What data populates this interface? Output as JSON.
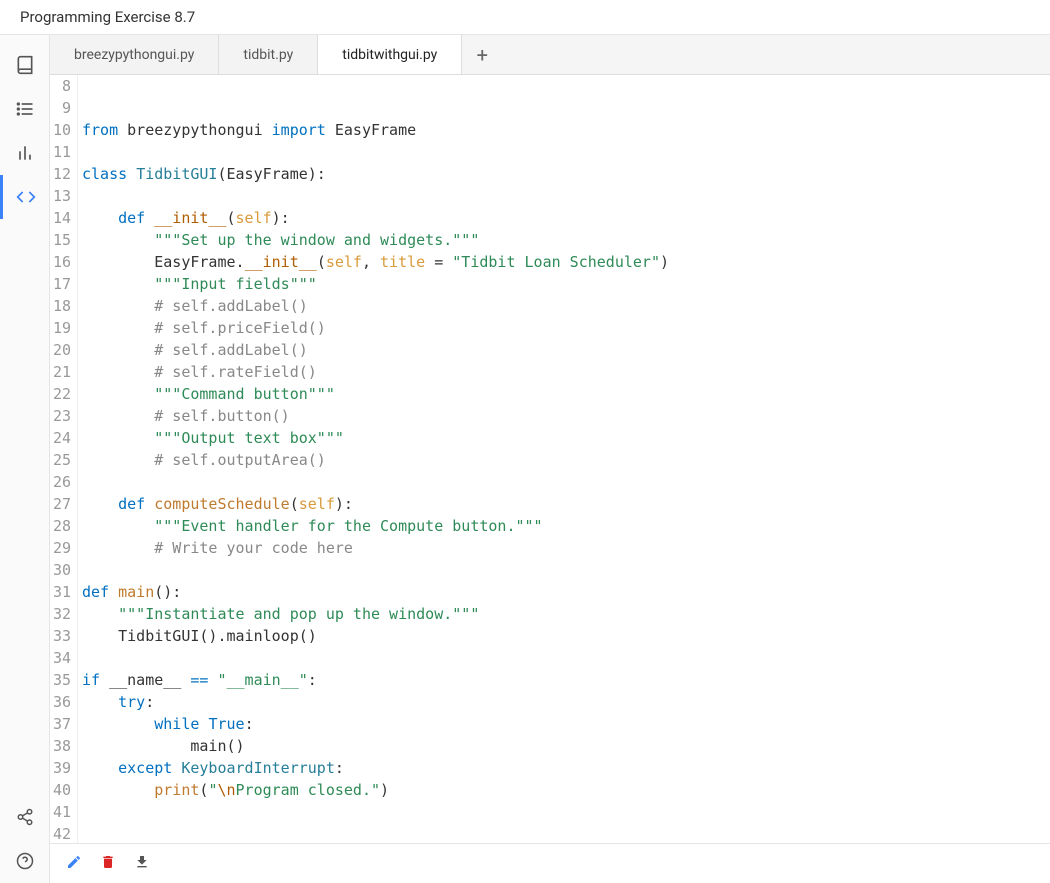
{
  "title": "Programming Exercise 8.7",
  "tabs": [
    {
      "label": "breezypythongui.py",
      "active": false
    },
    {
      "label": "tidbit.py",
      "active": false
    },
    {
      "label": "tidbitwithgui.py",
      "active": true
    }
  ],
  "add_tab_label": "+",
  "line_start": 8,
  "line_end": 42,
  "code_lines": [
    {
      "n": 8,
      "tokens": []
    },
    {
      "n": 9,
      "tokens": []
    },
    {
      "n": 10,
      "tokens": [
        [
          "kw",
          "from"
        ],
        [
          "",
          " breezypythongui "
        ],
        [
          "kw",
          "import"
        ],
        [
          "",
          " EasyFrame"
        ]
      ]
    },
    {
      "n": 11,
      "tokens": []
    },
    {
      "n": 12,
      "tokens": [
        [
          "kw",
          "class"
        ],
        [
          "",
          " "
        ],
        [
          "cls",
          "TidbitGUI"
        ],
        [
          "",
          "(EasyFrame):"
        ]
      ]
    },
    {
      "n": 13,
      "tokens": []
    },
    {
      "n": 14,
      "tokens": [
        [
          "",
          "    "
        ],
        [
          "kw",
          "def"
        ],
        [
          "",
          " "
        ],
        [
          "dunder",
          "__init__"
        ],
        [
          "",
          "("
        ],
        [
          "self",
          "self"
        ],
        [
          "",
          "):"
        ]
      ]
    },
    {
      "n": 15,
      "tokens": [
        [
          "",
          "        "
        ],
        [
          "str",
          "\"\"\"Set up the window and widgets.\"\"\""
        ]
      ]
    },
    {
      "n": 16,
      "tokens": [
        [
          "",
          "        EasyFrame."
        ],
        [
          "dunder",
          "__init__"
        ],
        [
          "",
          "("
        ],
        [
          "self",
          "self"
        ],
        [
          "",
          ", "
        ],
        [
          "self",
          "title"
        ],
        [
          "",
          " = "
        ],
        [
          "str",
          "\"Tidbit Loan Scheduler\""
        ],
        [
          "",
          ")"
        ]
      ]
    },
    {
      "n": 17,
      "tokens": [
        [
          "",
          "        "
        ],
        [
          "str",
          "\"\"\"Input fields\"\"\""
        ]
      ]
    },
    {
      "n": 18,
      "tokens": [
        [
          "",
          "        "
        ],
        [
          "com",
          "# self.addLabel()"
        ]
      ]
    },
    {
      "n": 19,
      "tokens": [
        [
          "",
          "        "
        ],
        [
          "com",
          "# self.priceField()"
        ]
      ]
    },
    {
      "n": 20,
      "tokens": [
        [
          "",
          "        "
        ],
        [
          "com",
          "# self.addLabel()"
        ]
      ]
    },
    {
      "n": 21,
      "tokens": [
        [
          "",
          "        "
        ],
        [
          "com",
          "# self.rateField()"
        ]
      ]
    },
    {
      "n": 22,
      "tokens": [
        [
          "",
          "        "
        ],
        [
          "str",
          "\"\"\"Command button\"\"\""
        ]
      ]
    },
    {
      "n": 23,
      "tokens": [
        [
          "",
          "        "
        ],
        [
          "com",
          "# self.button()"
        ]
      ]
    },
    {
      "n": 24,
      "tokens": [
        [
          "",
          "        "
        ],
        [
          "str",
          "\"\"\"Output text box\"\"\""
        ]
      ]
    },
    {
      "n": 25,
      "tokens": [
        [
          "",
          "        "
        ],
        [
          "com",
          "# self.outputArea()"
        ]
      ]
    },
    {
      "n": 26,
      "tokens": []
    },
    {
      "n": 27,
      "tokens": [
        [
          "",
          "    "
        ],
        [
          "kw",
          "def"
        ],
        [
          "",
          " "
        ],
        [
          "fn",
          "computeSchedule"
        ],
        [
          "",
          "("
        ],
        [
          "self",
          "self"
        ],
        [
          "",
          "):"
        ]
      ]
    },
    {
      "n": 28,
      "tokens": [
        [
          "",
          "        "
        ],
        [
          "str",
          "\"\"\"Event handler for the Compute button.\"\"\""
        ]
      ]
    },
    {
      "n": 29,
      "tokens": [
        [
          "",
          "        "
        ],
        [
          "com",
          "# Write your code here"
        ]
      ]
    },
    {
      "n": 30,
      "tokens": []
    },
    {
      "n": 31,
      "tokens": [
        [
          "kw",
          "def"
        ],
        [
          "",
          " "
        ],
        [
          "fn",
          "main"
        ],
        [
          "",
          "():"
        ]
      ]
    },
    {
      "n": 32,
      "tokens": [
        [
          "",
          "    "
        ],
        [
          "str",
          "\"\"\"Instantiate and pop up the window.\"\"\""
        ]
      ]
    },
    {
      "n": 33,
      "tokens": [
        [
          "",
          "    TidbitGUI().mainloop()"
        ]
      ]
    },
    {
      "n": 34,
      "tokens": []
    },
    {
      "n": 35,
      "tokens": [
        [
          "kw",
          "if"
        ],
        [
          "",
          " __name__ "
        ],
        [
          "kw",
          "=="
        ],
        [
          "",
          " "
        ],
        [
          "str",
          "\"__main__\""
        ],
        [
          "",
          ":"
        ]
      ]
    },
    {
      "n": 36,
      "tokens": [
        [
          "",
          "    "
        ],
        [
          "kw",
          "try"
        ],
        [
          "",
          ":"
        ]
      ]
    },
    {
      "n": 37,
      "tokens": [
        [
          "",
          "        "
        ],
        [
          "kw",
          "while"
        ],
        [
          "",
          " "
        ],
        [
          "kw",
          "True"
        ],
        [
          "",
          ":"
        ]
      ]
    },
    {
      "n": 38,
      "tokens": [
        [
          "",
          "            main()"
        ]
      ]
    },
    {
      "n": 39,
      "tokens": [
        [
          "",
          "    "
        ],
        [
          "kw",
          "except"
        ],
        [
          "",
          " "
        ],
        [
          "cls",
          "KeyboardInterrupt"
        ],
        [
          "",
          ":"
        ]
      ]
    },
    {
      "n": 40,
      "tokens": [
        [
          "",
          "        "
        ],
        [
          "fn",
          "print"
        ],
        [
          "",
          "("
        ],
        [
          "str",
          "\""
        ],
        [
          "esc",
          "\\n"
        ],
        [
          "str",
          "Program closed.\""
        ],
        [
          "",
          ")"
        ]
      ]
    },
    {
      "n": 41,
      "tokens": []
    },
    {
      "n": 42,
      "tokens": []
    }
  ],
  "rail_icons": [
    "book",
    "list",
    "chart",
    "code"
  ],
  "rail_bottom_icons": [
    "share",
    "help"
  ],
  "bottom_actions": [
    "edit",
    "delete",
    "download"
  ]
}
